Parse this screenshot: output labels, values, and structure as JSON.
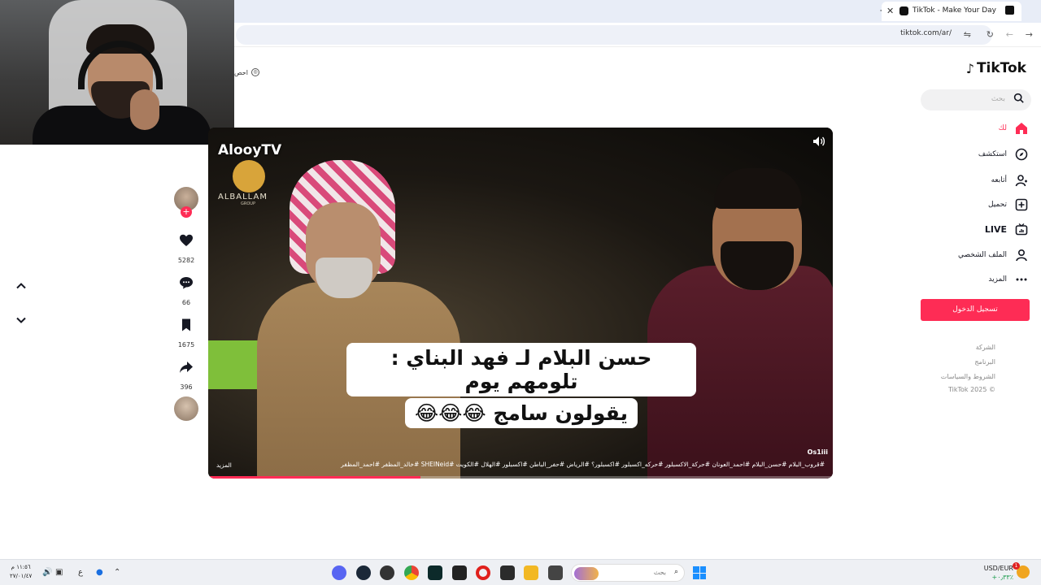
{
  "browser": {
    "tab_title": "TikTok - Make Your Day",
    "url": "tiktok.com/ar/",
    "new_tab": "+",
    "close_tab": "✕"
  },
  "left_snippet": "احص",
  "sidebar": {
    "logo_text": "TikTok",
    "search_placeholder": "بحث",
    "nav": [
      {
        "label": "لك",
        "icon": "home-icon"
      },
      {
        "label": "استكشف",
        "icon": "compass-icon"
      },
      {
        "label": "أتابعه",
        "icon": "following-icon"
      },
      {
        "label": "تحميل",
        "icon": "upload-icon"
      },
      {
        "label": "LIVE",
        "icon": "live-icon"
      },
      {
        "label": "الملف الشخصي",
        "icon": "profile-icon"
      },
      {
        "label": "المزيد",
        "icon": "more-icon"
      }
    ],
    "login_label": "تسجيل الدخول",
    "footer": [
      "الشركة",
      "البرنامج",
      "الشروط والسياسات",
      "TikTok 2025 ©"
    ]
  },
  "video": {
    "watermark_title": "AlooyTV",
    "watermark_sub": "ALBALLAM",
    "watermark_sub2": "GROUP",
    "caption_line1": "حسن البلام لـ فهد البناي : تلومهم يوم",
    "caption_line2": "يقولون سامج 😂😂😂",
    "handle": "Os1iii",
    "hashtags": "#قروب_البلام #حسن_البلام #احمد_العونان #حركة_الاكسبلور #حركه_اكسبلور #اكسبلور؟ #الرياض #حفر_الباطن #اكسبلور #الهلال #الكويت #SHEINeid #خالد_المظفر #احمد_المظفر",
    "more": "المزيد",
    "progress": 0.34
  },
  "actions": {
    "likes": "5282",
    "comments": "66",
    "saves": "1675",
    "shares": "396"
  },
  "taskbar": {
    "time": "١١:٥٦ م",
    "date": "٢٧/٠١/٤٧",
    "lang": "ع",
    "search_placeholder": "بحث",
    "fx_label": "USD/EUR",
    "fx_change": "+٠٫٣٣٪",
    "fx_badge": "1"
  },
  "colors": {
    "brand": "#fe2c55",
    "text": "#161823"
  }
}
